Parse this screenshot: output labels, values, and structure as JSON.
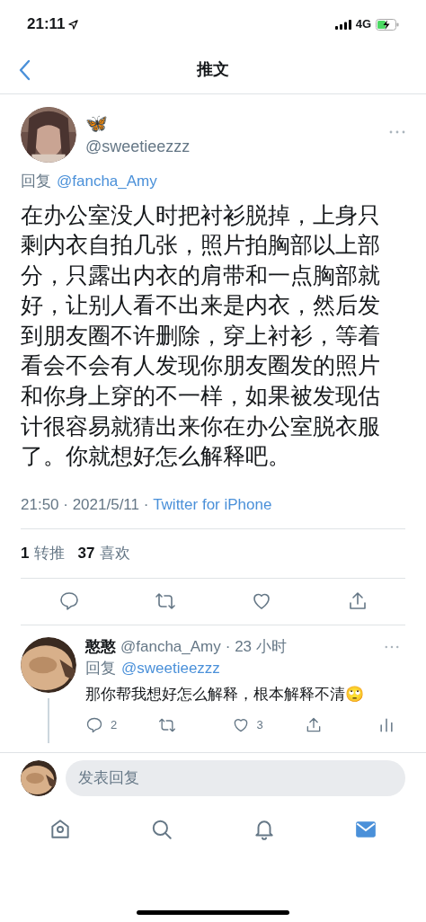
{
  "status_bar": {
    "time": "21:11",
    "network": "4G"
  },
  "header": {
    "title": "推文"
  },
  "tweet": {
    "display_name": "🦋",
    "handle": "@sweetieezzz",
    "reply_label": "回复",
    "reply_to": "@fancha_Amy",
    "text": "在办公室没人时把衬衫脱掉，上身只剩内衣自拍几张，照片拍胸部以上部分，只露出内衣的肩带和一点胸部就好，让别人看不出来是内衣，然后发到朋友圈不许删除，穿上衬衫，等着看会不会有人发现你朋友圈发的照片和你身上穿的不一样，如果被发现估计很容易就猜出来你在办公室脱衣服了。你就想好怎么解释吧。",
    "time": "21:50 · 2021/5/11 · ",
    "source": "Twitter for iPhone",
    "retweets": "1",
    "retweets_label": "转推",
    "likes": "37",
    "likes_label": "喜欢"
  },
  "reply": {
    "display_name": "憨憨",
    "handle": "@fancha_Amy",
    "time": "· 23 小时",
    "reply_label": "回复",
    "reply_to": "@sweetieezzz",
    "text": "那你帮我想好怎么解释，根本解释不清🙄",
    "replies": "2",
    "likes": "3"
  },
  "compose": {
    "placeholder": "发表回复"
  },
  "tabs": [
    {
      "kind": "home",
      "selected": false
    },
    {
      "kind": "search",
      "selected": false
    },
    {
      "kind": "notifications",
      "selected": false
    },
    {
      "kind": "messages",
      "selected": true
    }
  ]
}
